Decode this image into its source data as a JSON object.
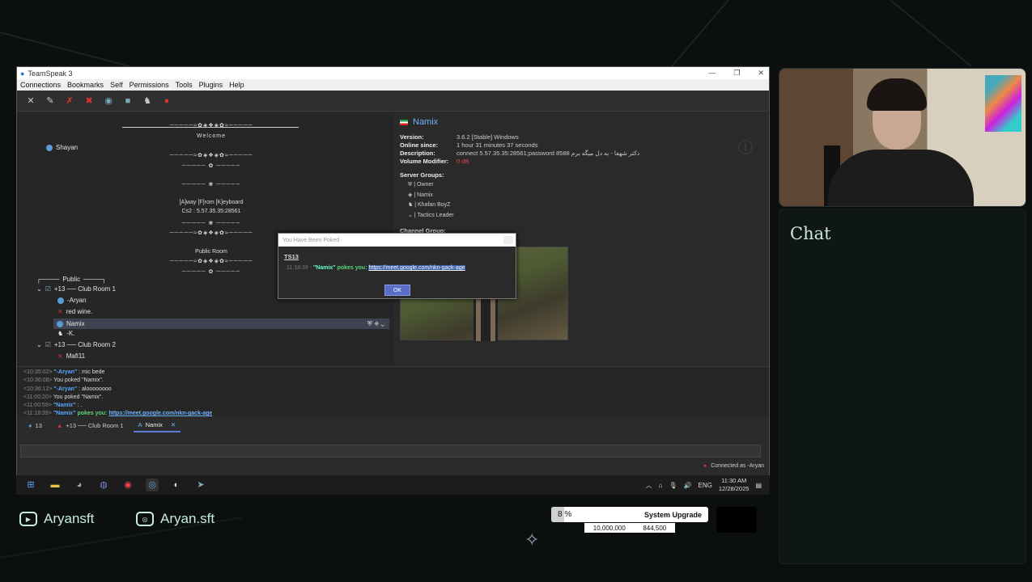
{
  "window": {
    "title": "TeamSpeak 3",
    "menu": [
      "Connections",
      "Bookmarks",
      "Self",
      "Permissions",
      "Tools",
      "Plugins",
      "Help"
    ]
  },
  "tree": {
    "spacer_welcome": "Welcome",
    "user_shayan": "Shayan",
    "afk_title": "[A]way [F]rom [K]eyboard",
    "afk_sub": "Cs2 : 5.57.35.35:28561",
    "public_room": "Public Room",
    "public_header": "Public",
    "club_room_1": "+13 ── Club Room 1",
    "aryan": "-Aryan",
    "red_wine": "red wine.",
    "namix": "Namix",
    "k": "-K.",
    "club_room_2": "+13 ── Club Room 2",
    "mafi": "Mafi11"
  },
  "info": {
    "name": "Namix",
    "version_label": "Version:",
    "version": "3.6.2 [Stable] Windows",
    "online_label": "Online since:",
    "online": "1 hour 31 minutes 37 seconds",
    "desc_label": "Description:",
    "desc": "connect 5.57.35.35:28561;password 8588 دکتر شهفا - به دل میگه برم",
    "volume_label": "Volume Modifier:",
    "volume": "0 dB",
    "server_groups_label": "Server Groups:",
    "groups": [
      "Owner",
      "Namix",
      "Khafan BoyZ",
      "Tactics Leader"
    ],
    "channel_group_label": "Channel Group:"
  },
  "poke": {
    "title": "You Have Been Poked",
    "server": "TS13",
    "time": "11:18:39 -",
    "name": "\"Namix\"",
    "verb": "pokes you:",
    "link": "https://meet.google.com/nkn-gack-age",
    "ok": "OK"
  },
  "chatlog": [
    {
      "t": "<10:35:02>",
      "n": "\"-Aryan\"",
      "m": ": mic bede",
      "c": ""
    },
    {
      "t": "<10:36:08>",
      "n": "",
      "m": "You poked \"Namix\".",
      "c": ""
    },
    {
      "t": "<10:36:12>",
      "n": "\"-Aryan\"",
      "m": ": aloooooooo",
      "c": ""
    },
    {
      "t": "<11:00:20>",
      "n": "",
      "m": "You poked \"Namix\".",
      "c": ""
    },
    {
      "t": "<11:00:59>",
      "n": "\"Namix\"",
      "m": ": .",
      "c": ""
    },
    {
      "t": "<11:18:39>",
      "n": "\"Namix\"",
      "m": "pokes you:",
      "c": "https://meet.google.com/nkn-gack-age"
    }
  ],
  "tabs": [
    "13",
    "+13 ── Club Room 1",
    "Namix"
  ],
  "status": "Connected as -Aryan",
  "tray": {
    "lang": "ENG",
    "time": "11:30 AM",
    "date": "12/28/2025"
  },
  "chat_panel_title": "Chat",
  "socials": {
    "youtube": "Aryansft",
    "instagram": "Aryan.sft"
  },
  "goal": {
    "percent_text": "8 %",
    "percent": 8,
    "label": "System Upgrade",
    "target": "10,000,000",
    "current": "844,500"
  },
  "colors": {
    "accent": "#6fb2ff",
    "poke_green": "#5ad47a",
    "chat_title": "#c9e8d8"
  }
}
